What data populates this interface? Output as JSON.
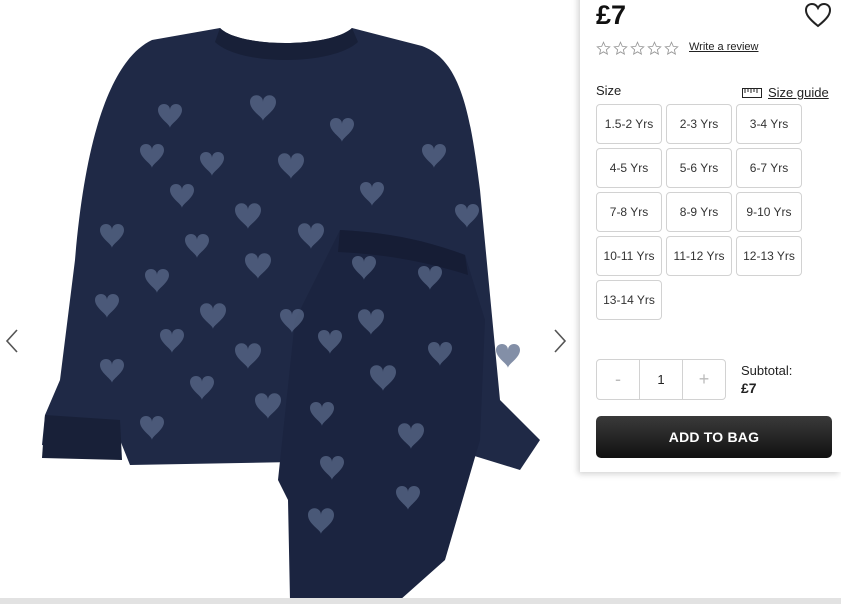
{
  "product": {
    "price": "£7",
    "rating": 0,
    "max_rating": 5,
    "write_review": "Write a review"
  },
  "size": {
    "label": "Size",
    "guide_label": "Size guide",
    "options": [
      "1.5-2 Yrs",
      "2-3 Yrs",
      "3-4 Yrs",
      "4-5 Yrs",
      "5-6 Yrs",
      "6-7 Yrs",
      "7-8 Yrs",
      "8-9 Yrs",
      "9-10 Yrs",
      "10-11 Yrs",
      "11-12 Yrs",
      "12-13 Yrs",
      "13-14 Yrs"
    ]
  },
  "quantity": {
    "decrement": "-",
    "value": "1",
    "increment": "+"
  },
  "subtotal": {
    "label": "Subtotal:",
    "value": "£7"
  },
  "cta": {
    "add_to_bag": "ADD TO BAG"
  },
  "icons": {
    "prev": "chevron-left-icon",
    "next": "chevron-right-icon",
    "wishlist": "heart-icon",
    "star": "star-outline-icon",
    "ruler": "ruler-icon"
  },
  "colors": {
    "garment": "#1f2946",
    "cta": "#1a1a1a",
    "border": "#d2d2d2"
  }
}
